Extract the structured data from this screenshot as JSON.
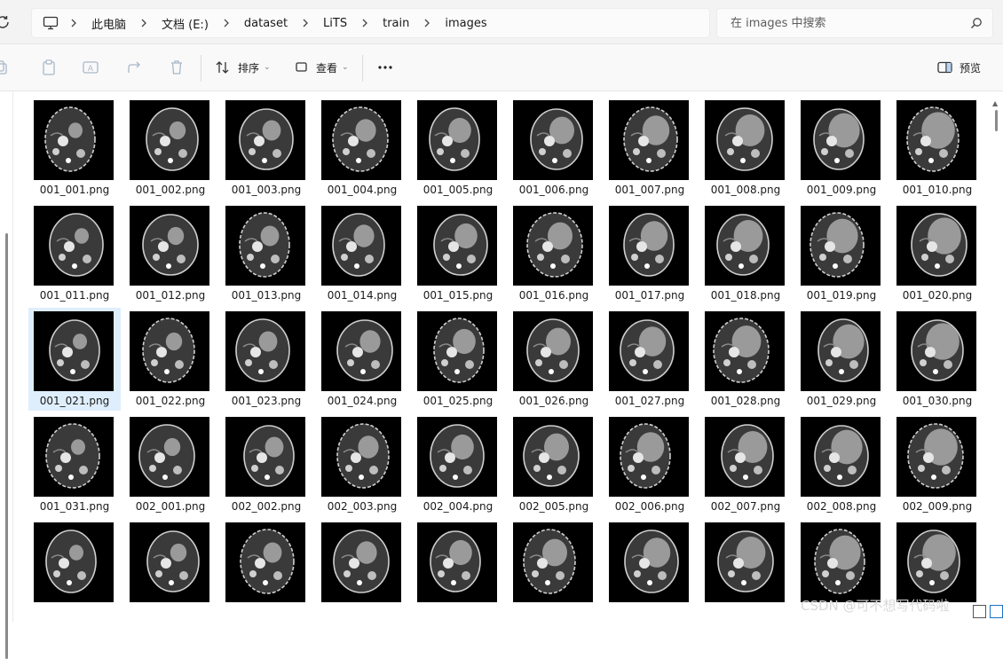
{
  "breadcrumb": [
    "此电脑",
    "文档 (E:)",
    "dataset",
    "LiTS",
    "train",
    "images"
  ],
  "search": {
    "placeholder": "在 images 中搜索"
  },
  "toolbar": {
    "sort_label": "排序",
    "view_label": "查看",
    "preview_label": "预览"
  },
  "files": [
    "001_001.png",
    "001_002.png",
    "001_003.png",
    "001_004.png",
    "001_005.png",
    "001_006.png",
    "001_007.png",
    "001_008.png",
    "001_009.png",
    "001_010.png",
    "001_011.png",
    "001_012.png",
    "001_013.png",
    "001_014.png",
    "001_015.png",
    "001_016.png",
    "001_017.png",
    "001_018.png",
    "001_019.png",
    "001_020.png",
    "001_021.png",
    "001_022.png",
    "001_023.png",
    "001_024.png",
    "001_025.png",
    "001_026.png",
    "001_027.png",
    "001_028.png",
    "001_029.png",
    "001_030.png",
    "001_031.png",
    "002_001.png",
    "002_002.png",
    "002_003.png",
    "002_004.png",
    "002_005.png",
    "002_006.png",
    "002_007.png",
    "002_008.png",
    "002_009.png",
    "",
    "",
    "",
    "",
    "",
    "",
    "",
    "",
    "",
    ""
  ],
  "selected_file": "001_021.png",
  "watermark": "CSDN @可不想写代码啦"
}
